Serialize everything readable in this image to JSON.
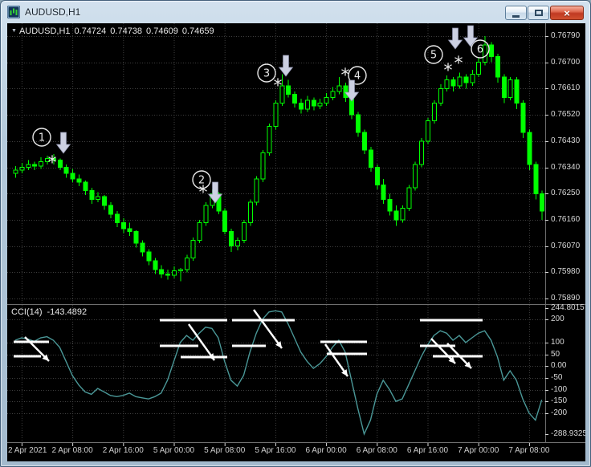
{
  "window": {
    "title": "AUDUSD,H1"
  },
  "icons": {
    "close_glyph": "×",
    "marker_glyph": "▼"
  },
  "chart": {
    "symbol_line": {
      "symbol": "AUDUSD,H1",
      "open": "0.74724",
      "high": "0.74738",
      "low": "0.74609",
      "close": "0.74659"
    },
    "price_axis": [
      "0.76790",
      "0.76700",
      "0.76610",
      "0.76520",
      "0.76430",
      "0.76340",
      "0.76250",
      "0.76160",
      "0.76070",
      "0.75980",
      "0.75890"
    ],
    "time_axis": [
      "2 Apr 2021",
      "2 Apr 08:00",
      "2 Apr 16:00",
      "5 Apr 00:00",
      "5 Apr 08:00",
      "5 Apr 16:00",
      "6 Apr 00:00",
      "6 Apr 08:00",
      "6 Apr 16:00",
      "7 Apr 00:00",
      "7 Apr 08:00"
    ]
  },
  "indicator": {
    "label": "CCI(14)",
    "value": "-143.4892",
    "axis": [
      "244.8015",
      "200",
      "100",
      "50",
      "0.00",
      "-50",
      "-100",
      "-150",
      "-200",
      "-288.9325"
    ]
  },
  "chart_data": {
    "type": "candlestick",
    "symbol": "AUDUSD",
    "timeframe": "H1",
    "price_range": [
      0.75874,
      0.76834
    ],
    "time_tick_indices": [
      1,
      9,
      17,
      25,
      33,
      41,
      49,
      57,
      65,
      73,
      81
    ],
    "candles": [
      [
        0.7632,
        0.76345,
        0.76305,
        0.7633
      ],
      [
        0.7633,
        0.76355,
        0.7632,
        0.7634
      ],
      [
        0.7634,
        0.76365,
        0.7633,
        0.7635
      ],
      [
        0.7635,
        0.7636,
        0.7633,
        0.76345
      ],
      [
        0.76345,
        0.76375,
        0.76335,
        0.7636
      ],
      [
        0.7636,
        0.7638,
        0.7635,
        0.7637
      ],
      [
        0.7637,
        0.76385,
        0.7635,
        0.76365
      ],
      [
        0.76365,
        0.7637,
        0.7633,
        0.7634
      ],
      [
        0.7634,
        0.7635,
        0.76305,
        0.7632
      ],
      [
        0.7632,
        0.76335,
        0.7629,
        0.763
      ],
      [
        0.763,
        0.76315,
        0.76275,
        0.7629
      ],
      [
        0.7629,
        0.76295,
        0.76245,
        0.7626
      ],
      [
        0.7626,
        0.7627,
        0.76215,
        0.7623
      ],
      [
        0.7623,
        0.76255,
        0.7622,
        0.7624
      ],
      [
        0.7624,
        0.76245,
        0.76195,
        0.7621
      ],
      [
        0.7621,
        0.7622,
        0.76165,
        0.7618
      ],
      [
        0.7618,
        0.7619,
        0.76135,
        0.7615
      ],
      [
        0.7615,
        0.76165,
        0.76115,
        0.7613
      ],
      [
        0.7613,
        0.7615,
        0.76105,
        0.7612
      ],
      [
        0.7612,
        0.76125,
        0.76065,
        0.7608
      ],
      [
        0.7608,
        0.7609,
        0.76035,
        0.7605
      ],
      [
        0.7605,
        0.7606,
        0.76005,
        0.7602
      ],
      [
        0.7602,
        0.7603,
        0.75975,
        0.7599
      ],
      [
        0.7599,
        0.76005,
        0.7596,
        0.75975
      ],
      [
        0.75975,
        0.7599,
        0.75955,
        0.7597
      ],
      [
        0.7597,
        0.76,
        0.7596,
        0.75985
      ],
      [
        0.75985,
        0.75995,
        0.7595,
        0.7599
      ],
      [
        0.7599,
        0.7604,
        0.7598,
        0.7603
      ],
      [
        0.7603,
        0.761,
        0.7602,
        0.7609
      ],
      [
        0.7609,
        0.7616,
        0.7608,
        0.7615
      ],
      [
        0.7615,
        0.7622,
        0.7614,
        0.7621
      ],
      [
        0.7621,
        0.76265,
        0.762,
        0.7625
      ],
      [
        0.7625,
        0.76255,
        0.7618,
        0.7619
      ],
      [
        0.7619,
        0.762,
        0.7611,
        0.7612
      ],
      [
        0.7612,
        0.7613,
        0.7605,
        0.7607
      ],
      [
        0.7607,
        0.761,
        0.76055,
        0.7609
      ],
      [
        0.7609,
        0.7616,
        0.7608,
        0.7615
      ],
      [
        0.7615,
        0.7623,
        0.7614,
        0.7622
      ],
      [
        0.7622,
        0.7631,
        0.7621,
        0.763
      ],
      [
        0.763,
        0.764,
        0.7629,
        0.7639
      ],
      [
        0.7639,
        0.7649,
        0.7638,
        0.7648
      ],
      [
        0.7648,
        0.7657,
        0.7647,
        0.7656
      ],
      [
        0.7656,
        0.7666,
        0.7655,
        0.7662
      ],
      [
        0.7662,
        0.7664,
        0.7658,
        0.7659
      ],
      [
        0.7659,
        0.766,
        0.76545,
        0.7656
      ],
      [
        0.7656,
        0.76575,
        0.76525,
        0.7654
      ],
      [
        0.7654,
        0.76585,
        0.7653,
        0.7657
      ],
      [
        0.7657,
        0.7658,
        0.76535,
        0.7655
      ],
      [
        0.7655,
        0.76575,
        0.7654,
        0.7656
      ],
      [
        0.7656,
        0.76595,
        0.7655,
        0.7658
      ],
      [
        0.7658,
        0.76615,
        0.7657,
        0.766
      ],
      [
        0.766,
        0.7665,
        0.7659,
        0.7662
      ],
      [
        0.7662,
        0.7663,
        0.76565,
        0.7658
      ],
      [
        0.7658,
        0.7659,
        0.76505,
        0.7652
      ],
      [
        0.7652,
        0.7653,
        0.76445,
        0.7646
      ],
      [
        0.7646,
        0.7647,
        0.76385,
        0.764
      ],
      [
        0.764,
        0.7641,
        0.76325,
        0.7634
      ],
      [
        0.7634,
        0.7635,
        0.76265,
        0.7628
      ],
      [
        0.7628,
        0.763,
        0.76215,
        0.7623
      ],
      [
        0.7623,
        0.7625,
        0.76175,
        0.7619
      ],
      [
        0.7619,
        0.7621,
        0.7614,
        0.7616
      ],
      [
        0.7616,
        0.7621,
        0.7615,
        0.762
      ],
      [
        0.762,
        0.7628,
        0.7619,
        0.7627
      ],
      [
        0.7627,
        0.7636,
        0.7626,
        0.7635
      ],
      [
        0.7635,
        0.7644,
        0.7634,
        0.7643
      ],
      [
        0.7643,
        0.7651,
        0.7642,
        0.765
      ],
      [
        0.765,
        0.7657,
        0.7649,
        0.7656
      ],
      [
        0.7656,
        0.76625,
        0.7655,
        0.7661
      ],
      [
        0.7661,
        0.76655,
        0.766,
        0.7664
      ],
      [
        0.7664,
        0.7665,
        0.766,
        0.7662
      ],
      [
        0.7662,
        0.76665,
        0.7661,
        0.7665
      ],
      [
        0.7665,
        0.7666,
        0.7661,
        0.7663
      ],
      [
        0.7663,
        0.76675,
        0.7662,
        0.7666
      ],
      [
        0.7666,
        0.76715,
        0.7665,
        0.767
      ],
      [
        0.767,
        0.7679,
        0.7669,
        0.7676
      ],
      [
        0.7676,
        0.7677,
        0.767,
        0.7672
      ],
      [
        0.7672,
        0.7673,
        0.7663,
        0.7665
      ],
      [
        0.7665,
        0.7666,
        0.7656,
        0.7658
      ],
      [
        0.7658,
        0.7665,
        0.7657,
        0.7664
      ],
      [
        0.7664,
        0.7665,
        0.7654,
        0.7656
      ],
      [
        0.7656,
        0.7657,
        0.7644,
        0.7646
      ],
      [
        0.7646,
        0.7647,
        0.7633,
        0.7635
      ],
      [
        0.7635,
        0.7636,
        0.7623,
        0.7625
      ],
      [
        0.7625,
        0.7626,
        0.7616,
        0.7619
      ]
    ],
    "indicator": {
      "name": "CCI",
      "period": 14,
      "current_value": -143.4892,
      "range": [
        -320,
        260
      ],
      "grid_levels": [
        200,
        100,
        50,
        0,
        -50,
        -100,
        -150,
        -200
      ],
      "values": [
        110,
        120,
        115,
        105,
        120,
        125,
        110,
        80,
        20,
        -40,
        -80,
        -110,
        -120,
        -95,
        -110,
        -125,
        -130,
        -125,
        -115,
        -130,
        -135,
        -140,
        -130,
        -115,
        -60,
        20,
        100,
        130,
        110,
        140,
        165,
        160,
        120,
        20,
        -60,
        -85,
        -40,
        60,
        140,
        200,
        230,
        235,
        230,
        180,
        120,
        60,
        20,
        -10,
        10,
        40,
        80,
        110,
        60,
        -60,
        -180,
        -288.93,
        -230,
        -120,
        -60,
        -100,
        -150,
        -140,
        -80,
        -20,
        40,
        90,
        130,
        150,
        140,
        110,
        130,
        100,
        120,
        140,
        150,
        110,
        40,
        -60,
        -20,
        -60,
        -140,
        -200,
        -230,
        -143.49
      ]
    }
  },
  "annotations": {
    "marks": [
      {
        "n": "1",
        "circle": [
          43,
          142
        ],
        "arrows": [
          [
            70,
            136
          ]
        ],
        "stars": [
          [
            56,
            173
          ]
        ]
      },
      {
        "n": "2",
        "circle": [
          242,
          195
        ],
        "arrows": [
          [
            259,
            198
          ]
        ],
        "stars": [
          [
            244,
            210
          ]
        ]
      },
      {
        "n": "3",
        "circle": [
          323,
          62
        ],
        "arrows": [
          [
            347,
            40
          ]
        ],
        "stars": [
          [
            337,
            77
          ]
        ]
      },
      {
        "n": "4",
        "circle": [
          436,
          65
        ],
        "arrows": [
          [
            429,
            71
          ]
        ],
        "stars": [
          [
            421,
            64
          ]
        ]
      },
      {
        "n": "5",
        "circle": [
          531,
          39
        ],
        "arrows": [],
        "stars": [
          [
            549,
            58
          ],
          [
            562,
            49
          ]
        ]
      },
      {
        "n": "6",
        "circle": [
          589,
          32
        ],
        "arrows": [
          [
            558,
            6
          ],
          [
            577,
            3
          ]
        ],
        "stars": []
      }
    ],
    "cci_dashes": [
      [
        8,
        397,
        52,
        397
      ],
      [
        8,
        415,
        42,
        415
      ],
      [
        190,
        370,
        274,
        370
      ],
      [
        190,
        402,
        238,
        402
      ],
      [
        216,
        416,
        274,
        416
      ],
      [
        280,
        370,
        358,
        370
      ],
      [
        280,
        402,
        322,
        402
      ],
      [
        390,
        397,
        448,
        397
      ],
      [
        398,
        412,
        448,
        412
      ],
      [
        514,
        370,
        592,
        370
      ],
      [
        514,
        402,
        558,
        402
      ],
      [
        530,
        415,
        592,
        415
      ]
    ],
    "cci_arrows": [
      [
        22,
        391,
        52,
        421
      ],
      [
        226,
        375,
        258,
        420
      ],
      [
        307,
        357,
        342,
        405
      ],
      [
        396,
        400,
        424,
        440
      ],
      [
        528,
        393,
        558,
        424
      ],
      [
        548,
        399,
        578,
        430
      ]
    ]
  },
  "colors": {
    "background": "#000000",
    "bull_outline": "#00ff00",
    "bear_fill": "#00ff00",
    "grid": "#3f3f3f",
    "separator": "#6e6e6e",
    "cci_line": "#4a9797",
    "annotation_white": "#ffffff",
    "mark_stroke": "#e9e9e9",
    "arrow_fill": "#ccd0e2",
    "arrow_edge": "#8f93ad",
    "axis_text": "#d8d8d8"
  }
}
